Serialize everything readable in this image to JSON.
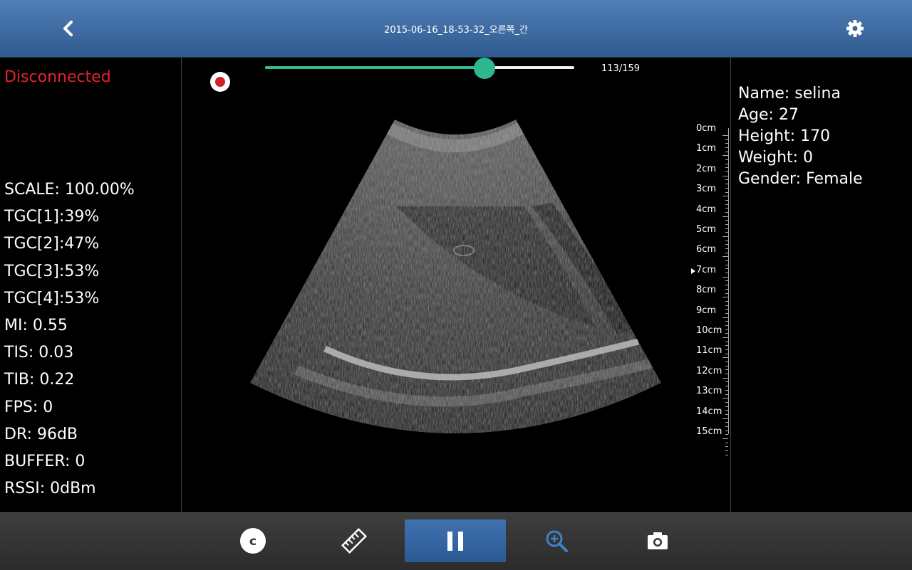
{
  "header": {
    "title": "2015-06-16_18-53-32_오른쪽_간",
    "icons": {
      "back": "chevron-left-icon",
      "settings": "gear-icon"
    }
  },
  "status": {
    "text": "Disconnected",
    "color": "#e0262c"
  },
  "metrics": [
    "SCALE: 100.00%",
    "TGC[1]:39%",
    "TGC[2]:47%",
    "TGC[3]:53%",
    "TGC[4]:53%",
    "MI: 0.55",
    "TIS: 0.03",
    "TIB: 0.22",
    "FPS: 0",
    "DR: 96dB",
    "BUFFER: 0",
    "RSSI: 0dBm"
  ],
  "patient": [
    "Name: selina",
    "Age: 27",
    "Height: 170",
    "Weight: 0",
    "Gender: Female"
  ],
  "playback": {
    "current": 113,
    "total": 159,
    "label": "113/159",
    "accent": "#2fbf95"
  },
  "depth_scale": {
    "labels": [
      "0cm",
      "1cm",
      "2cm",
      "3cm",
      "4cm",
      "5cm",
      "6cm",
      "7cm",
      "8cm",
      "9cm",
      "10cm",
      "11cm",
      "12cm",
      "13cm",
      "14cm",
      "15cm"
    ],
    "focus_cm": 7
  },
  "toolbar": {
    "icons": [
      "c-circle-icon",
      "ruler-icon",
      "pause-icon",
      "zoom-in-icon",
      "camera-icon"
    ],
    "accent": "#2b5a94"
  }
}
